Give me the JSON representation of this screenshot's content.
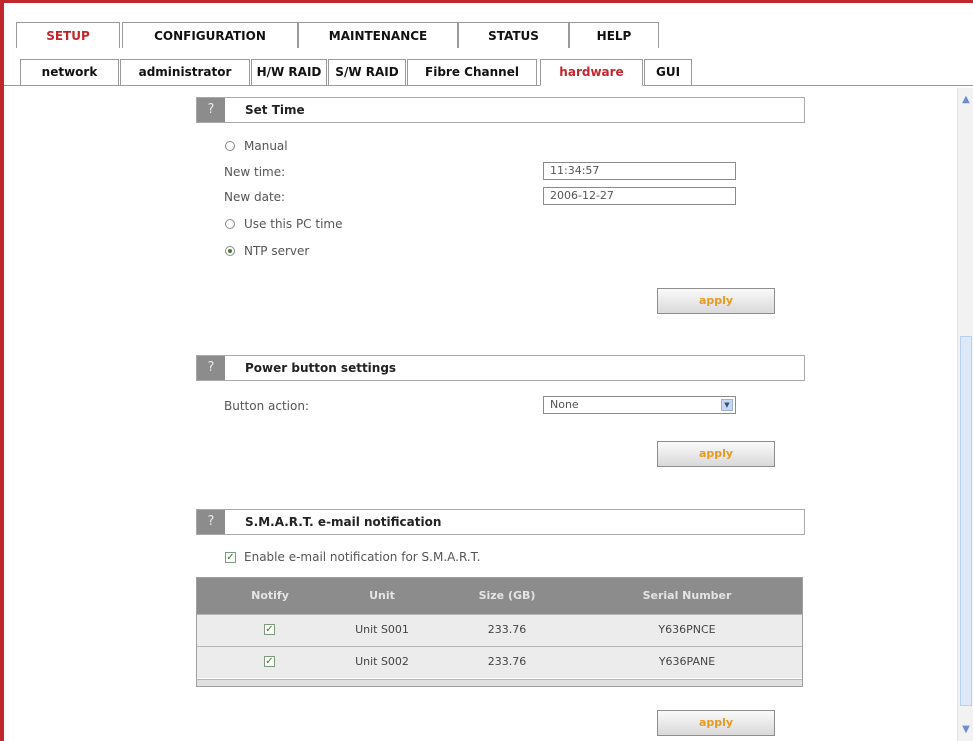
{
  "main_tabs": [
    {
      "label": "SETUP",
      "active": true
    },
    {
      "label": "CONFIGURATION",
      "active": false
    },
    {
      "label": "MAINTENANCE",
      "active": false
    },
    {
      "label": "STATUS",
      "active": false
    },
    {
      "label": "HELP",
      "active": false
    }
  ],
  "sub_tabs": [
    {
      "label": "network",
      "active": false
    },
    {
      "label": "administrator",
      "active": false
    },
    {
      "label": "H/W RAID",
      "active": false
    },
    {
      "label": "S/W RAID",
      "active": false
    },
    {
      "label": "Fibre Channel",
      "active": false
    },
    {
      "label": "hardware",
      "active": true
    },
    {
      "label": "GUI",
      "active": false
    }
  ],
  "colors": {
    "accent": "#c0272d",
    "apply_text": "#e69a1f",
    "section_icon_bg": "#8c8c8c"
  },
  "set_time": {
    "help_icon": "?",
    "title": "Set Time",
    "manual_label": "Manual",
    "new_time_label": "New time:",
    "new_time_value": "11:34:57",
    "new_date_label": "New date:",
    "new_date_value": "2006-12-27",
    "use_pc_time_label": "Use this PC time",
    "ntp_label": "NTP server",
    "selected": "ntp",
    "apply_label": "apply"
  },
  "power_button": {
    "help_icon": "?",
    "title": "Power button settings",
    "action_label": "Button action:",
    "action_value": "None",
    "apply_label": "apply"
  },
  "smart": {
    "help_icon": "?",
    "title": "S.M.A.R.T. e-mail notification",
    "enable_label": "Enable e-mail notification for S.M.A.R.T.",
    "enable_checked": true,
    "columns": [
      "Notify",
      "Unit",
      "Size (GB)",
      "Serial Number"
    ],
    "rows": [
      {
        "notify": true,
        "unit": "Unit S001",
        "size": "233.76",
        "serial": "Y636PNCE"
      },
      {
        "notify": true,
        "unit": "Unit S002",
        "size": "233.76",
        "serial": "Y636PANE"
      }
    ],
    "apply_label": "apply"
  },
  "icons": {
    "check": "✓",
    "arrow_down": "▼",
    "scroll_up": "▲",
    "scroll_down": "▼"
  }
}
